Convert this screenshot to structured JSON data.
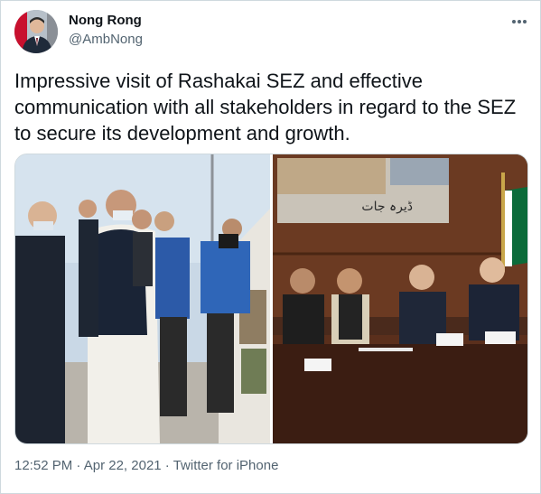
{
  "author": {
    "name": "Nong Rong",
    "handle": "@AmbNong"
  },
  "tweet": {
    "text": "Impressive visit of Rashakai SEZ and effective communication with all stakeholders in regard to the SEZ to secure its development and growth."
  },
  "media": {
    "photo_left_alt": "",
    "photo_right_banner_text": "ڈیرہ جات"
  },
  "meta": {
    "time": "12:52 PM",
    "separator1": " · ",
    "date": "Apr 22, 2021",
    "separator2": " · ",
    "source": "Twitter for iPhone"
  },
  "icons": {
    "more": "more-horizontal-icon"
  },
  "colors": {
    "text": "#0f1419",
    "secondary": "#536471",
    "border": "#cfd9de"
  }
}
